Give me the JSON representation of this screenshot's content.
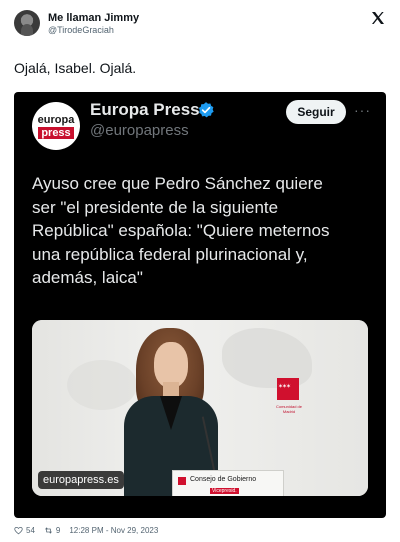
{
  "header": {
    "user_name": "Me llaman Jimmy",
    "user_handle": "@TirodeGraciah",
    "close_icon": "x-logo-icon"
  },
  "tweet": {
    "text": "Ojalá, Isabel. Ojalá."
  },
  "embed": {
    "logo": {
      "line1": "europa",
      "line2": "press"
    },
    "account_name": "Europa Press",
    "account_handle": "@europapress",
    "follow_label": "Seguir",
    "more_label": "···",
    "headline_lines": [
      "Ayuso cree que Pedro Sánchez quiere",
      "ser \"el presidente de la siguiente",
      "República\" española: \"Quiere meternos",
      "una república federal plurinacional y,",
      "además, laica\""
    ],
    "photo": {
      "source_label": "europapress.es",
      "podium_text": "Consejo de Gobierno",
      "podium_sub": "Vicepresid.",
      "wall_logo_text": "Comunidad de Madrid"
    },
    "colors": {
      "background": "#000000",
      "brand_red": "#c8102e",
      "verified_blue": "#1d9bf0"
    }
  },
  "footer": {
    "likes": "54",
    "retweets": "9",
    "timestamp": "12:28 PM - Nov 29, 2023"
  }
}
